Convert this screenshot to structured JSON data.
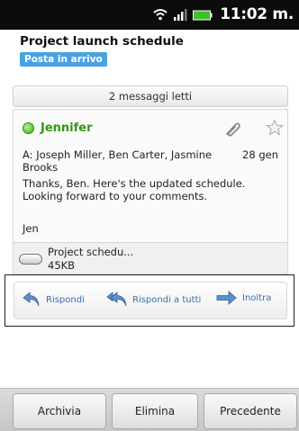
{
  "status_bar": {
    "time": "11:02 m."
  },
  "header": {
    "subject": "Project launch schedule",
    "folder_badge": "Posta in arrivo"
  },
  "read_messages": "2 messaggi letti",
  "message": {
    "sender": "Jennifer",
    "recipients": "A: Joseph Miller, Ben Carter, Jasmine Brooks",
    "date": "28 gen",
    "body": "Thanks, Ben. Here's the updated schedule. Looking forward to your comments.",
    "signature": "Jen",
    "attachment": {
      "name": "Project schedu...",
      "size": "45KB"
    }
  },
  "actions": {
    "reply": "Rispondi",
    "reply_all": "Rispondi a tutti",
    "forward": "Inoltra"
  },
  "toolbar": {
    "archive": "Archivia",
    "delete": "Elimina",
    "previous": "Precedente"
  },
  "colors": {
    "accent_green": "#2f9a16",
    "badge_blue": "#4aa3e0",
    "action_blue": "#3a6fb0"
  }
}
